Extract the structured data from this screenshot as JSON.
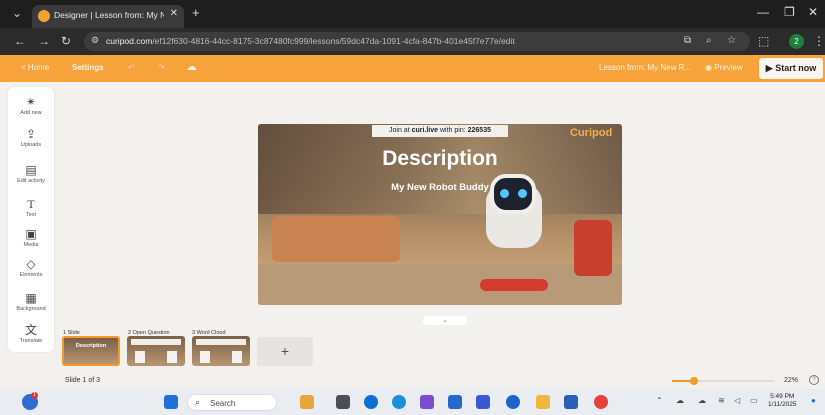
{
  "browser": {
    "tab_title": "Designer | Lesson from: My Ne",
    "tab_close": "✕",
    "new_tab": "+",
    "url_host": "curipod.com",
    "url_path": "/ef12f630-4816-44cc-8175-3c87480fc999/lessons/59dc47da-1091-4cfa-847b-401e45f7e77e/edit",
    "profile_initial": "2"
  },
  "appbar": {
    "home_label": "< Home",
    "settings_label": "Settings",
    "lesson_label": "Lesson from: My New R...",
    "preview_label": "Preview",
    "start_label": "▶ Start now"
  },
  "sidebar": {
    "items": [
      {
        "icon": "add-new-icon",
        "label": "Add new"
      },
      {
        "icon": "upload-icon",
        "label": "Uploads"
      },
      {
        "icon": "edit-activity-icon",
        "label": "Edit activity"
      },
      {
        "icon": "text-icon",
        "label": "Text"
      },
      {
        "icon": "media-icon",
        "label": "Media"
      },
      {
        "icon": "elements-icon",
        "label": "Elements"
      },
      {
        "icon": "background-icon",
        "label": "Background"
      },
      {
        "icon": "translate-icon",
        "label": "Translate"
      }
    ]
  },
  "slide": {
    "pin_prefix": "Join at ",
    "pin_site": "curi.live",
    "pin_mid": " with pin: ",
    "pin_code": "226535",
    "brand": "Curipod",
    "title": "Description",
    "subtitle": "My New Robot Buddy"
  },
  "thumbnails": [
    {
      "label": "1 Slide",
      "title": "Description"
    },
    {
      "label": "2 Open Question",
      "title": ""
    },
    {
      "label": "3 Word Cloud",
      "title": ""
    }
  ],
  "footer": {
    "slide_count": "Slide 1 of 3",
    "zoom": "22%",
    "zoom_fraction": 0.22
  },
  "taskbar": {
    "search_label": "Search",
    "time": "5:49 PM",
    "date": "1/11/2025",
    "weather_badge": "1"
  },
  "colors": {
    "accent": "#f7a23b",
    "active_border": "#f39a2b"
  }
}
